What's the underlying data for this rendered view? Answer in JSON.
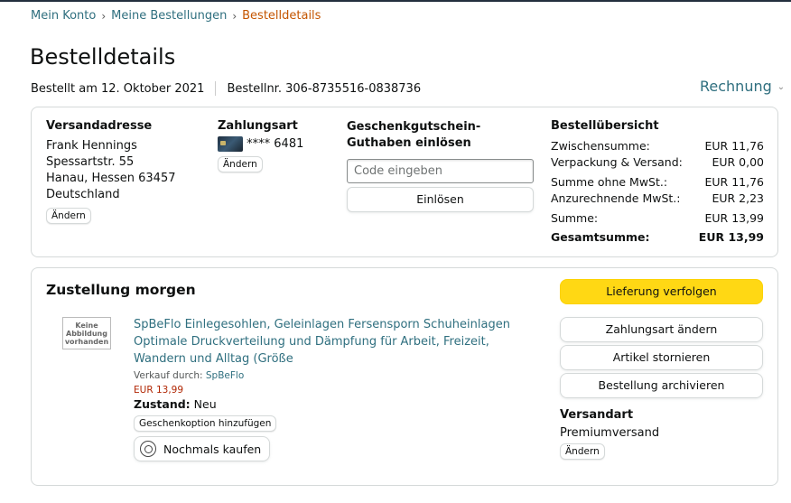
{
  "breadcrumb": {
    "account": "Mein Konto",
    "orders": "Meine Bestellungen",
    "current": "Bestelldetails",
    "sep": "›"
  },
  "page": {
    "title": "Bestelldetails",
    "ordered_on": "Bestellt am 12. Oktober 2021",
    "order_no": "Bestellnr. 306-8735516-0838736",
    "invoice": "Rechnung",
    "invoice_chev": "⌄"
  },
  "address": {
    "title": "Versandadresse",
    "lines": [
      "Frank Hennings",
      "Spessartstr. 55",
      "Hanau, Hessen 63457",
      "Deutschland"
    ],
    "change": "Ändern"
  },
  "payment": {
    "title": "Zahlungsart",
    "card": "**** 6481",
    "change": "Ändern"
  },
  "voucher": {
    "title": "Geschenkgutschein-Guthaben einlösen",
    "placeholder": "Code eingeben",
    "redeem": "Einlösen"
  },
  "summary": {
    "title": "Bestellübersicht",
    "rows": [
      {
        "label": "Zwischensumme:",
        "value": "EUR 11,76"
      },
      {
        "label": "Verpackung & Versand:",
        "value": "EUR 0,00"
      },
      {
        "label": "Summe ohne MwSt.:",
        "value": "EUR 11,76"
      },
      {
        "label": "Anzurechnende MwSt.:",
        "value": "EUR 2,23"
      },
      {
        "label": "Summe:",
        "value": "EUR 13,99"
      },
      {
        "label": "Gesamtsumme:",
        "value": "EUR 13,99"
      }
    ]
  },
  "delivery": {
    "title": "Zustellung morgen",
    "no_image": "Keine Abbildung vorhanden",
    "product_title": "SpBeFlo Einlegesohlen, Geleinlagen Fersensporn Schuheinlagen Optimale Druckverteilung und Dämpfung für Arbeit, Freizeit, Wandern und Alltag (Größe",
    "seller_prefix": "Verkauf durch: ",
    "seller": "SpBeFlo",
    "price": "EUR 13,99",
    "condition_label": "Zustand:",
    "condition_value": "Neu",
    "gift_option": "Geschenkoption hinzufügen",
    "buy_again": "Nochmals kaufen"
  },
  "actions": {
    "track": "Lieferung verfolgen",
    "change_payment": "Zahlungsart ändern",
    "cancel": "Artikel stornieren",
    "archive": "Bestellung archivieren",
    "shipping_title": "Versandart",
    "shipping_value": "Premiumversand",
    "shipping_change": "Ändern"
  }
}
